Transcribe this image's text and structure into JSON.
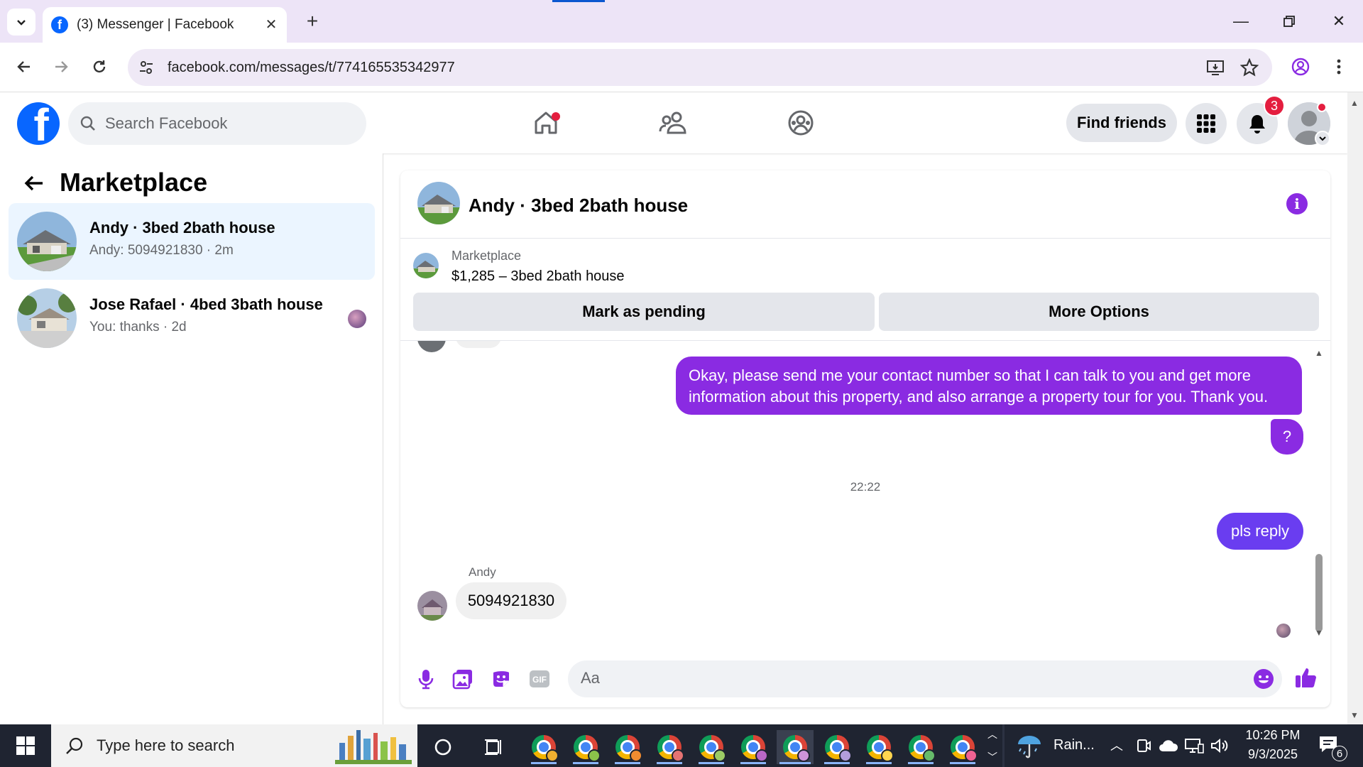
{
  "browser": {
    "tab_title": "(3) Messenger | Facebook",
    "url": "facebook.com/messages/t/774165535342977"
  },
  "fb": {
    "search_placeholder": "Search Facebook",
    "find_friends": "Find friends",
    "notification_count": "3"
  },
  "left_panel": {
    "title": "Marketplace",
    "conversations": [
      {
        "name": "Andy · 3bed 2bath house",
        "preview": "Andy: 5094921830 · 2m",
        "active": true
      },
      {
        "name": "Jose Rafael · 4bed 3bath house",
        "preview": "You: thanks · 2d",
        "active": false
      }
    ]
  },
  "chat": {
    "title": "Andy · 3bed 2bath house",
    "listing": {
      "label": "Marketplace",
      "price_title": "$1,285 – 3bed 2bath house",
      "mark_pending": "Mark as pending",
      "more_options": "More Options"
    },
    "messages": {
      "out1_line1": "Okay, please send me your contact number so that I can talk to you and get more",
      "out1_line2": "information about this property, and also arrange a property tour for you. Thank you.",
      "out2": "?",
      "timestamp": "22:22",
      "out3": "pls reply",
      "in_sender": "Andy",
      "in1": "5094921830"
    },
    "composer_placeholder": "Aa"
  },
  "taskbar": {
    "search_placeholder": "Type here to search",
    "weather": "Rain...",
    "time": "10:26 PM",
    "date": "9/3/2025",
    "notification_count": "6"
  },
  "colors": {
    "fb_blue": "#0866ff",
    "messenger_purple": "#8a2be2",
    "active_conv": "#ebf5ff"
  }
}
